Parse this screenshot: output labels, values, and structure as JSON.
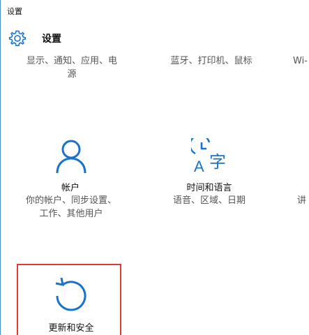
{
  "window": {
    "title": "设置"
  },
  "header": {
    "title": "设置",
    "icon": "gear-icon"
  },
  "top_row": [
    {
      "line1": "显示、通知、应用、电",
      "line2": "源"
    },
    {
      "line1": "蓝牙、打印机、鼠标"
    },
    {
      "line1": "Wi-"
    }
  ],
  "tiles": [
    {
      "icon": "person-icon",
      "title": "帐户",
      "desc_line1": "你的帐户、同步设置、",
      "desc_line2": "工作、其他用户"
    },
    {
      "icon": "time-language-icon",
      "title": "时间和语言",
      "desc_line1": "语音、区域、日期",
      "icon_glyph_letter": "A",
      "icon_glyph_char": "字"
    },
    {
      "desc_line1": "讲"
    },
    {
      "icon": "update-sync-icon",
      "title": "更新和安全"
    }
  ],
  "colors": {
    "accent": "#1a73c9",
    "highlight": "#e03a3a"
  }
}
